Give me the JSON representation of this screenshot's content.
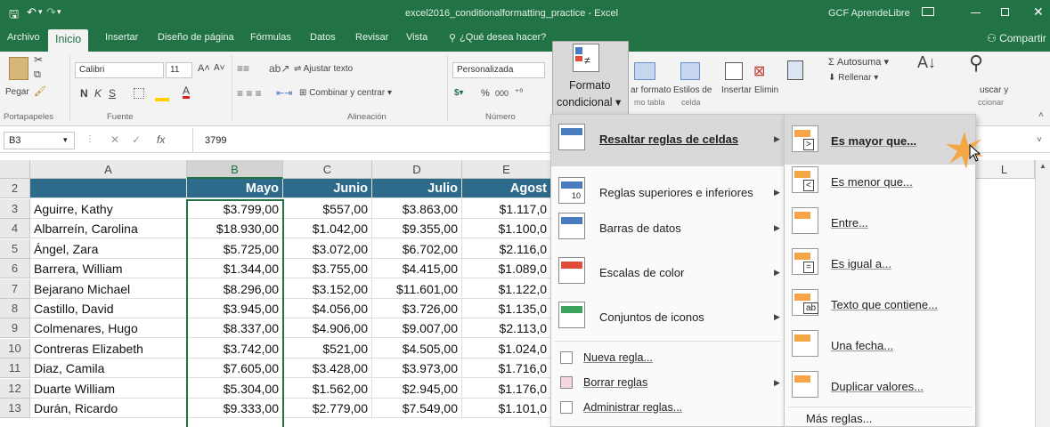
{
  "titlebar": {
    "title": "excel2016_conditionalformatting_practice - Excel",
    "user": "GCF AprendeLibre"
  },
  "tabs": [
    {
      "label": "Archivo"
    },
    {
      "label": "Inicio"
    },
    {
      "label": "Insertar"
    },
    {
      "label": "Diseño de página"
    },
    {
      "label": "Fórmulas"
    },
    {
      "label": "Datos"
    },
    {
      "label": "Revisar"
    },
    {
      "label": "Vista"
    }
  ],
  "tellme": "¿Qué desea hacer?",
  "share": "Compartir",
  "ribbon": {
    "paste": "Pegar",
    "font_name": "Calibri",
    "font_size": "11",
    "bold": "N",
    "italic": "K",
    "underline": "S",
    "wrap_text": "Ajustar texto",
    "merge_center": "Combinar y centrar",
    "number_format": "Personalizada",
    "percent": "%",
    "thousands": "000",
    "cond_format_line1": "Formato",
    "cond_format_line2": "condicional",
    "format_table": "ar formato",
    "format_table_2": "mo tabla",
    "cell_styles": "Estilos de",
    "cell_styles_2": "celda",
    "insert": "Insertar",
    "delete": "Elimin",
    "autosum": "Autosuma",
    "fill": "Rellenar",
    "find_1": "uscar y",
    "find_2": "ccionar",
    "group_clipboard": "Portapapeles",
    "group_font": "Fuente",
    "group_alignment": "Alineación",
    "group_number": "Número"
  },
  "formula_bar": {
    "name_box": "B3",
    "fx": "fx",
    "value": "3799"
  },
  "columns": [
    "A",
    "B",
    "C",
    "D",
    "E",
    "L"
  ],
  "header_row": {
    "row": "2",
    "cells": [
      "",
      "Mayo",
      "Junio",
      "Julio",
      "Agost"
    ]
  },
  "rows": [
    {
      "row": "3",
      "name": "Aguirre, Kathy",
      "b": "$3.799,00",
      "c": "$557,00",
      "d": "$3.863,00",
      "e": "$1.117,0"
    },
    {
      "row": "4",
      "name": "Albarreín, Carolina",
      "b": "$18.930,00",
      "c": "$1.042,00",
      "d": "$9.355,00",
      "e": "$1.100,0"
    },
    {
      "row": "5",
      "name": "Ángel, Zara",
      "b": "$5.725,00",
      "c": "$3.072,00",
      "d": "$6.702,00",
      "e": "$2.116,0"
    },
    {
      "row": "6",
      "name": "Barrera, William",
      "b": "$1.344,00",
      "c": "$3.755,00",
      "d": "$4.415,00",
      "e": "$1.089,0"
    },
    {
      "row": "7",
      "name": "Bejarano Michael",
      "b": "$8.296,00",
      "c": "$3.152,00",
      "d": "$11.601,00",
      "e": "$1.122,0"
    },
    {
      "row": "8",
      "name": "Castillo, David",
      "b": "$3.945,00",
      "c": "$4.056,00",
      "d": "$3.726,00",
      "e": "$1.135,0"
    },
    {
      "row": "9",
      "name": "Colmenares, Hugo",
      "b": "$8.337,00",
      "c": "$4.906,00",
      "d": "$9.007,00",
      "e": "$2.113,0"
    },
    {
      "row": "10",
      "name": "Contreras Elizabeth",
      "b": "$3.742,00",
      "c": "$521,00",
      "d": "$4.505,00",
      "e": "$1.024,0"
    },
    {
      "row": "11",
      "name": "Diaz, Camila",
      "b": "$7.605,00",
      "c": "$3.428,00",
      "d": "$3.973,00",
      "e": "$1.716,0"
    },
    {
      "row": "12",
      "name": "Duarte William",
      "b": "$5.304,00",
      "c": "$1.562,00",
      "d": "$2.945,00",
      "e": "$1.176,0"
    },
    {
      "row": "13",
      "name": "Durán, Ricardo",
      "b": "$9.333,00",
      "c": "$2.779,00",
      "d": "$7.549,00",
      "e": "$1.101,0"
    }
  ],
  "cf_menu": {
    "items": [
      {
        "label": "Resaltar reglas de celdas",
        "icon": "highlight-rules-icon"
      },
      {
        "label": "Reglas superiores e inferiores",
        "icon": "top-bottom-rules-icon",
        "icon_text": "10"
      },
      {
        "label": "Barras de datos",
        "icon": "data-bars-icon"
      },
      {
        "label": "Escalas de color",
        "icon": "color-scales-icon"
      },
      {
        "label": "Conjuntos de iconos",
        "icon": "icon-sets-icon"
      }
    ],
    "small_items": [
      {
        "label": "Nueva regla...",
        "icon": "new-rule-icon"
      },
      {
        "label": "Borrar reglas",
        "icon": "clear-rules-icon"
      },
      {
        "label": "Administrar reglas...",
        "icon": "manage-rules-icon"
      }
    ]
  },
  "sub_menu": {
    "items": [
      {
        "label": "Es mayor que...",
        "glyph": ">"
      },
      {
        "label": "Es menor que...",
        "glyph": "<"
      },
      {
        "label": "Entre...",
        "glyph": ""
      },
      {
        "label": "Es igual a...",
        "glyph": "="
      },
      {
        "label": "Texto que contiene...",
        "glyph": "ab"
      },
      {
        "label": "Una fecha...",
        "glyph": ""
      },
      {
        "label": "Duplicar valores...",
        "glyph": ""
      }
    ],
    "more": "Más reglas..."
  },
  "colors": {
    "excel_green": "#217346",
    "header_blue": "#2e6b8a",
    "highlight_orange": "#f4a544",
    "icon_blue": "#4a7dbf"
  }
}
